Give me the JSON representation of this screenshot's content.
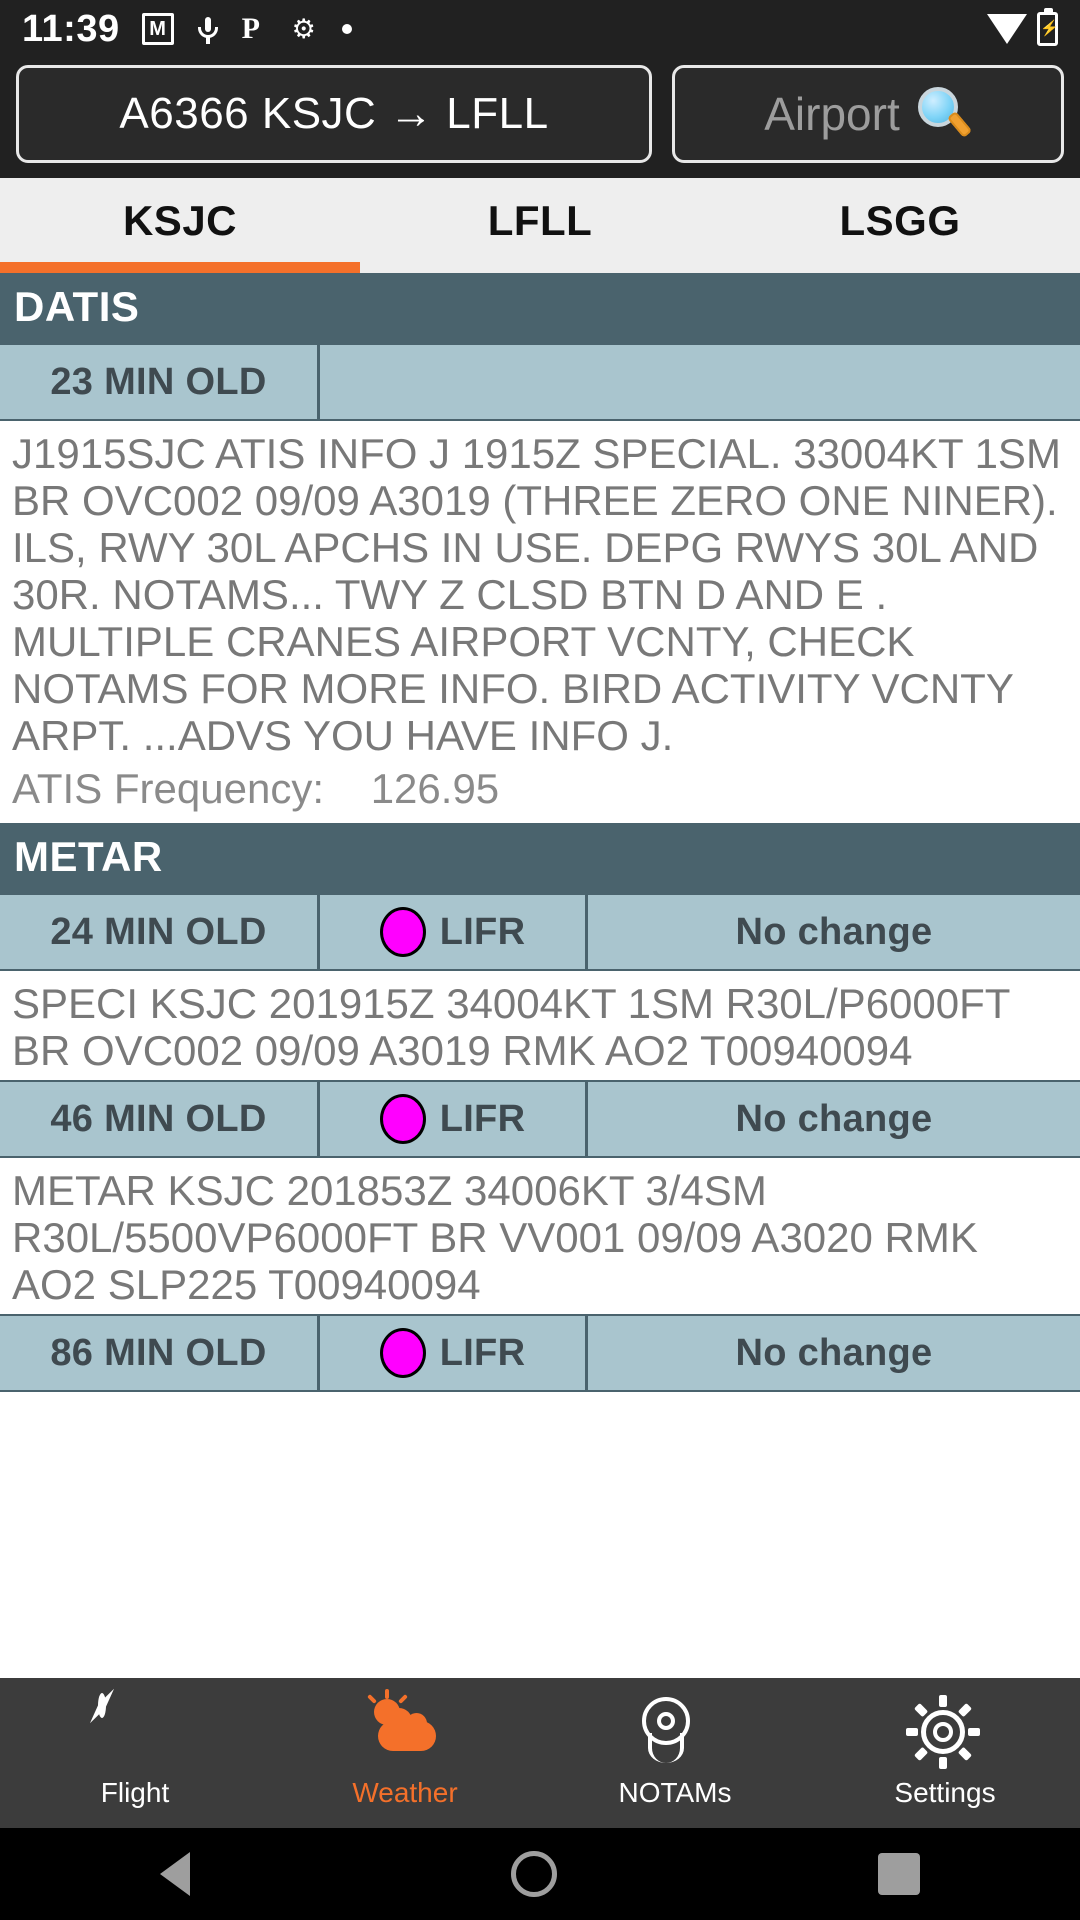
{
  "status_bar": {
    "time": "11:39",
    "icons": [
      "gmail-icon",
      "microphone-icon",
      "pocketcasts-icon",
      "bug-icon",
      "dot-icon"
    ],
    "right_icons": [
      "wifi-icon",
      "battery-charging-icon"
    ]
  },
  "header": {
    "route_label": "A6366 KSJC → LFLL",
    "airport_search_label": "Airport",
    "search_icon": "magnifier-icon"
  },
  "tabs": {
    "items": [
      {
        "label": "KSJC",
        "active": true
      },
      {
        "label": "LFLL",
        "active": false
      },
      {
        "label": "LSGG",
        "active": false
      }
    ],
    "active_index": 0,
    "accent_color": "#f4702a"
  },
  "sections": {
    "datis": {
      "title": "DATIS",
      "age": "23 MIN OLD",
      "text": "J1915SJC ATIS INFO J 1915Z SPECIAL. 33004KT 1SM BR OVC002 09/09 A3019 (THREE ZERO ONE NINER). ILS, RWY 30L APCHS IN USE. DEPG RWYS 30L AND 30R. NOTAMS... TWY Z CLSD BTN D AND E . MULTIPLE CRANES AIRPORT VCNTY, CHECK NOTAMS FOR MORE INFO. BIRD ACTIVITY VCNTY ARPT. ...ADVS YOU HAVE INFO J.",
      "frequency_label": "ATIS Frequency:",
      "frequency_value": "126.95"
    },
    "metar": {
      "title": "METAR",
      "entries": [
        {
          "age": "24 MIN OLD",
          "category": "LIFR",
          "category_color": "#ff00ff",
          "trend": "No change",
          "text": "SPECI KSJC 201915Z 34004KT 1SM R30L/P6000FT BR OVC002 09/09 A3019 RMK AO2 T00940094"
        },
        {
          "age": "46 MIN OLD",
          "category": "LIFR",
          "category_color": "#ff00ff",
          "trend": "No change",
          "text": "METAR KSJC 201853Z 34006KT 3/4SM R30L/5500VP6000FT BR VV001 09/09 A3020 RMK AO2 SLP225 T00940094"
        },
        {
          "age": "86 MIN OLD",
          "category": "LIFR",
          "category_color": "#ff00ff",
          "trend": "No change",
          "text": ""
        }
      ]
    }
  },
  "bottom_nav": {
    "items": [
      {
        "label": "Flight",
        "icon": "compass-icon",
        "active": false
      },
      {
        "label": "Weather",
        "icon": "sun-cloud-icon",
        "active": true
      },
      {
        "label": "NOTAMs",
        "icon": "map-pin-icon",
        "active": false
      },
      {
        "label": "Settings",
        "icon": "gear-icon",
        "active": false
      }
    ],
    "active_color": "#f4702a"
  },
  "system_nav": {
    "back": "back-triangle-icon",
    "home": "home-circle-icon",
    "recents": "recents-square-icon"
  }
}
